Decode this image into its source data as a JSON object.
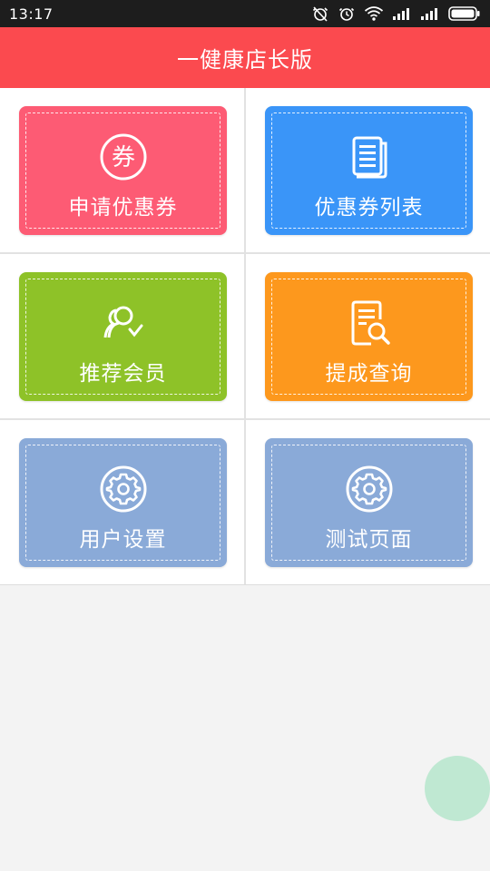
{
  "status_bar": {
    "time": "13:17"
  },
  "header": {
    "title": "一健康店长版"
  },
  "menu": [
    {
      "label": "申请优惠券",
      "icon": "coupon-icon",
      "color": "#fd5b74"
    },
    {
      "label": "优惠券列表",
      "icon": "document-list-icon",
      "color": "#3a95f8"
    },
    {
      "label": "推荐会员",
      "icon": "recommend-user-icon",
      "color": "#8ec228"
    },
    {
      "label": "提成查询",
      "icon": "search-document-icon",
      "color": "#fd981d"
    },
    {
      "label": "用户设置",
      "icon": "gear-icon",
      "color": "#8aaad8"
    },
    {
      "label": "测试页面",
      "icon": "gear-icon",
      "color": "#8aaad8"
    }
  ],
  "colors": {
    "header": "#fb4a4f",
    "status_bar": "#1d1d1d",
    "background": "#f3f3f3",
    "fab": "#bfe8d2"
  }
}
